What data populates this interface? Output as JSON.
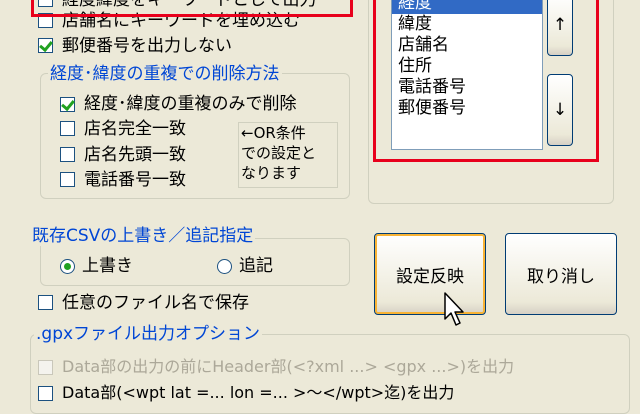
{
  "options": {
    "top_partial_label": "経度緯度をキーワードとして出力",
    "embed_store_name": "店舗名にキーワードを埋め込む",
    "no_postal_code": "郵便番号を出力しない"
  },
  "duplicate_group": {
    "title": "経度･緯度の重複での削除方法",
    "only_coords": "経度･緯度の重複のみで削除",
    "name_exact": "店名完全一致",
    "name_prefix": "店名先頭一致",
    "phone_exact": "電話番号一致",
    "note": "←OR条件\nでの設定と\nなります"
  },
  "order_list": {
    "items": [
      "経度",
      "緯度",
      "店舗名",
      "住所",
      "電話番号",
      "郵便番号"
    ],
    "selected_index": 0,
    "up_label": "↑",
    "down_label": "↓"
  },
  "csv_group": {
    "title": "既存CSVの上書き／追記指定",
    "overwrite": "上書き",
    "append": "追記"
  },
  "buttons": {
    "apply": "設定反映",
    "cancel": "取り消し"
  },
  "save_any_name": "任意のファイル名で保存",
  "gpx_group": {
    "title": ".gpxファイル出力オプション",
    "header_option": "Data部の出力の前にHeader部(<?xml ...> <gpx ...>)を出力",
    "wpt_option": "Data部(<wpt lat =... lon =... >〜</wpt>迄)を出力"
  },
  "colors": {
    "highlight_border": "#e8001c",
    "group_title": "#0046d5",
    "check_mark": "#21a121",
    "selection": "#316ac5"
  }
}
